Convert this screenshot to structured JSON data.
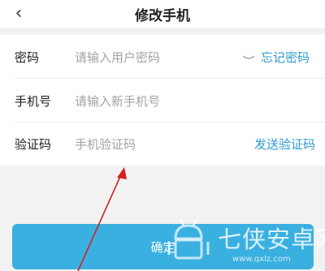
{
  "nav": {
    "back_icon": "chevron-left-icon",
    "title": "修改手机"
  },
  "form": {
    "password": {
      "label": "密码",
      "placeholder": "请输入用户密码",
      "eye_icon": "eye-closed-icon",
      "forgot_link": "忘记密码"
    },
    "phone": {
      "label": "手机号",
      "placeholder": "请输入新手机号"
    },
    "code": {
      "label": "验证码",
      "placeholder": "手机验证码",
      "send_link": "发送验证码"
    }
  },
  "confirm_button": "确定",
  "watermark": {
    "text": "七侠安卓网",
    "url": "www.qxlz.com"
  },
  "colors": {
    "link": "#2f9bd0",
    "button": "#3ab0e0",
    "annotation_arrow": "#d62020"
  }
}
